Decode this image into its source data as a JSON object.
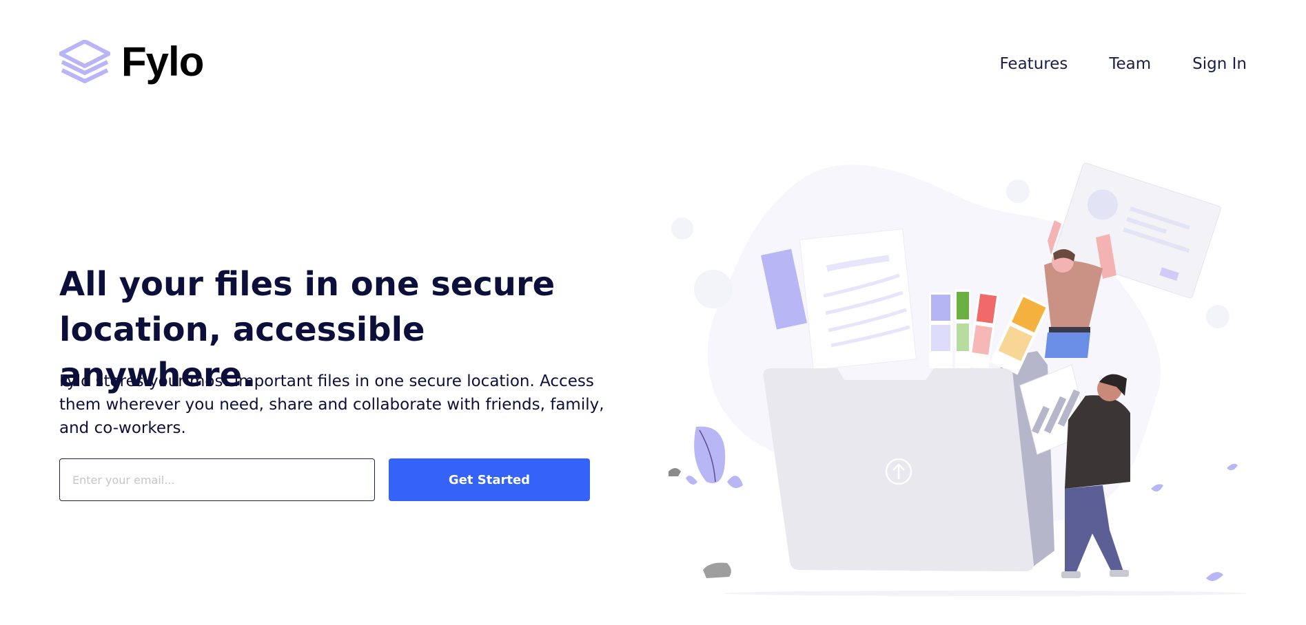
{
  "header": {
    "logo_text": "Fylo",
    "nav": [
      {
        "label": "Features"
      },
      {
        "label": "Team"
      },
      {
        "label": "Sign In"
      }
    ]
  },
  "hero": {
    "title": "All your files in one secure location, accessible anywhere.",
    "description": "Fylo stores your most important files in one secure location. Access them wherever you need, share and collaborate with friends, family, and co-workers.",
    "email_placeholder": "Enter your email...",
    "email_value": "",
    "cta_label": "Get Started"
  },
  "colors": {
    "accent": "#3563f7",
    "text_dark": "#0c0f3a",
    "logo_icon": "#b9b4f5"
  },
  "icons": {
    "logo": "stacked-layers-icon",
    "upload": "upload-arrow-icon"
  }
}
